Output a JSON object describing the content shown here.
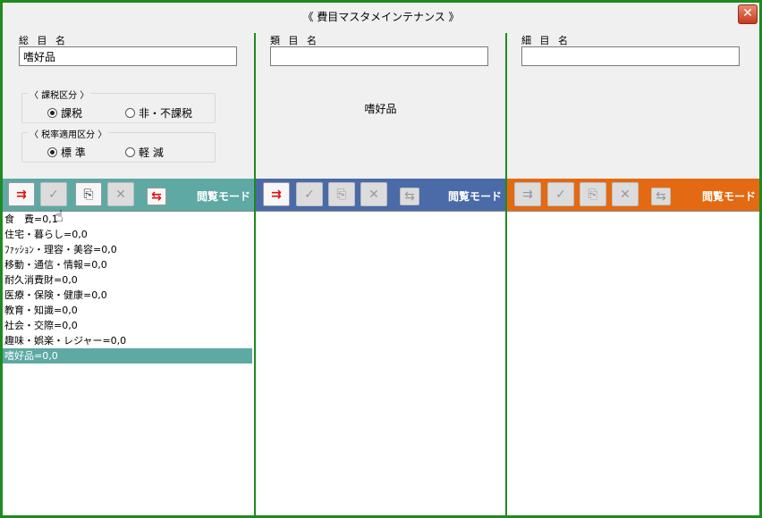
{
  "window": {
    "title": "《 費目マスタメインテナンス 》",
    "close_glyph": "✕"
  },
  "col1": {
    "label": "総 目 名",
    "value": "嗜好品",
    "tax_group": {
      "label": "〈 課税区分 〉",
      "options": [
        "課税",
        "非・不課税"
      ],
      "selected": 0
    },
    "rate_group": {
      "label": "〈 税率適用区分 〉",
      "options": [
        "標 準",
        "軽 減"
      ],
      "selected": 0
    },
    "toolbar_color": "#5ea9a4",
    "mode": "閲覧モード",
    "items": [
      "食　費=0,1",
      "住宅・暮らし=0,0",
      "ﾌｧｯｼｮﾝ・理容・美容=0,0",
      "移動・通信・情報=0,0",
      "耐久消費財=0,0",
      "医療・保険・健康=0,0",
      "教育・知識=0,0",
      "社会・交際=0,0",
      "趣味・娯楽・レジャー=0,0",
      "嗜好品=0,0"
    ],
    "selected_index": 9
  },
  "col2": {
    "label": "類 目 名",
    "value": "",
    "parent_text": "嗜好品",
    "toolbar_color": "#4a6aa8",
    "mode": "閲覧モード"
  },
  "col3": {
    "label": "細 目 名",
    "value": "",
    "toolbar_color": "#e36a12",
    "mode": "閲覧モード"
  },
  "icons": {
    "insert": "insert-row-icon",
    "confirm": "checkmark-icon",
    "copy": "copy-doc-icon",
    "delete": "delete-x-icon",
    "move": "move-row-icon"
  }
}
